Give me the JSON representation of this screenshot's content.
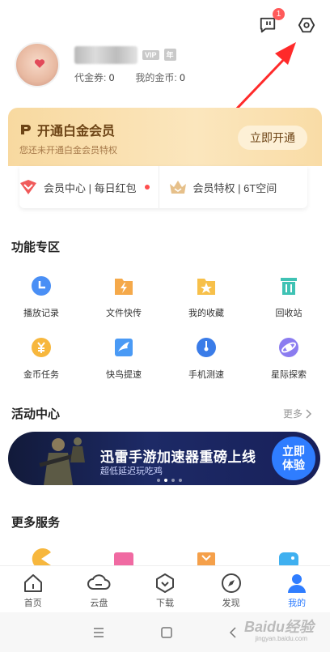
{
  "header": {
    "message_badge": "1"
  },
  "profile": {
    "tags": [
      "VIP",
      "年"
    ],
    "coupon_label": "代金券:",
    "coupon_value": "0",
    "coins_label": "我的金币:",
    "coins_value": "0"
  },
  "vip": {
    "title": "开通白金会员",
    "subtitle": "您还未开通白金会员特权",
    "button": "立即开通",
    "links": [
      {
        "label": "会员中心 | 每日红包",
        "icon": "red-heart-icon"
      },
      {
        "label": "会员特权 | 6T空间",
        "icon": "gold-crown-icon"
      }
    ]
  },
  "features": {
    "title": "功能专区",
    "items": [
      {
        "label": "播放记录",
        "icon": "clock-icon",
        "color": "#4a8ff5"
      },
      {
        "label": "文件快传",
        "icon": "lightning-folder-icon",
        "color": "#f5a94a"
      },
      {
        "label": "我的收藏",
        "icon": "star-folder-icon",
        "color": "#f7c04a"
      },
      {
        "label": "回收站",
        "icon": "trash-icon",
        "color": "#3fc2b4"
      },
      {
        "label": "金币任务",
        "icon": "yuan-coin-icon",
        "color": "#f7b73d"
      },
      {
        "label": "快鸟提速",
        "icon": "bird-icon",
        "color": "#4a9af5"
      },
      {
        "label": "手机测速",
        "icon": "speed-gauge-icon",
        "color": "#3a7ce8"
      },
      {
        "label": "星际探索",
        "icon": "planet-icon",
        "color": "#8b7cf0"
      }
    ]
  },
  "activity": {
    "title": "活动中心",
    "more": "更多",
    "banner_title": "迅雷手游加速器重磅上线",
    "banner_subtitle": "超低延迟玩吃鸡",
    "banner_button": "立即\n体验"
  },
  "services": {
    "title": "更多服务"
  },
  "tabbar": [
    {
      "label": "首页",
      "icon": "home-icon"
    },
    {
      "label": "云盘",
      "icon": "cloud-icon"
    },
    {
      "label": "下载",
      "icon": "download-icon"
    },
    {
      "label": "发现",
      "icon": "compass-icon"
    },
    {
      "label": "我的",
      "icon": "person-icon",
      "active": true
    }
  ],
  "watermark": {
    "brand": "Baidu经验",
    "url": "jingyan.baidu.com"
  }
}
